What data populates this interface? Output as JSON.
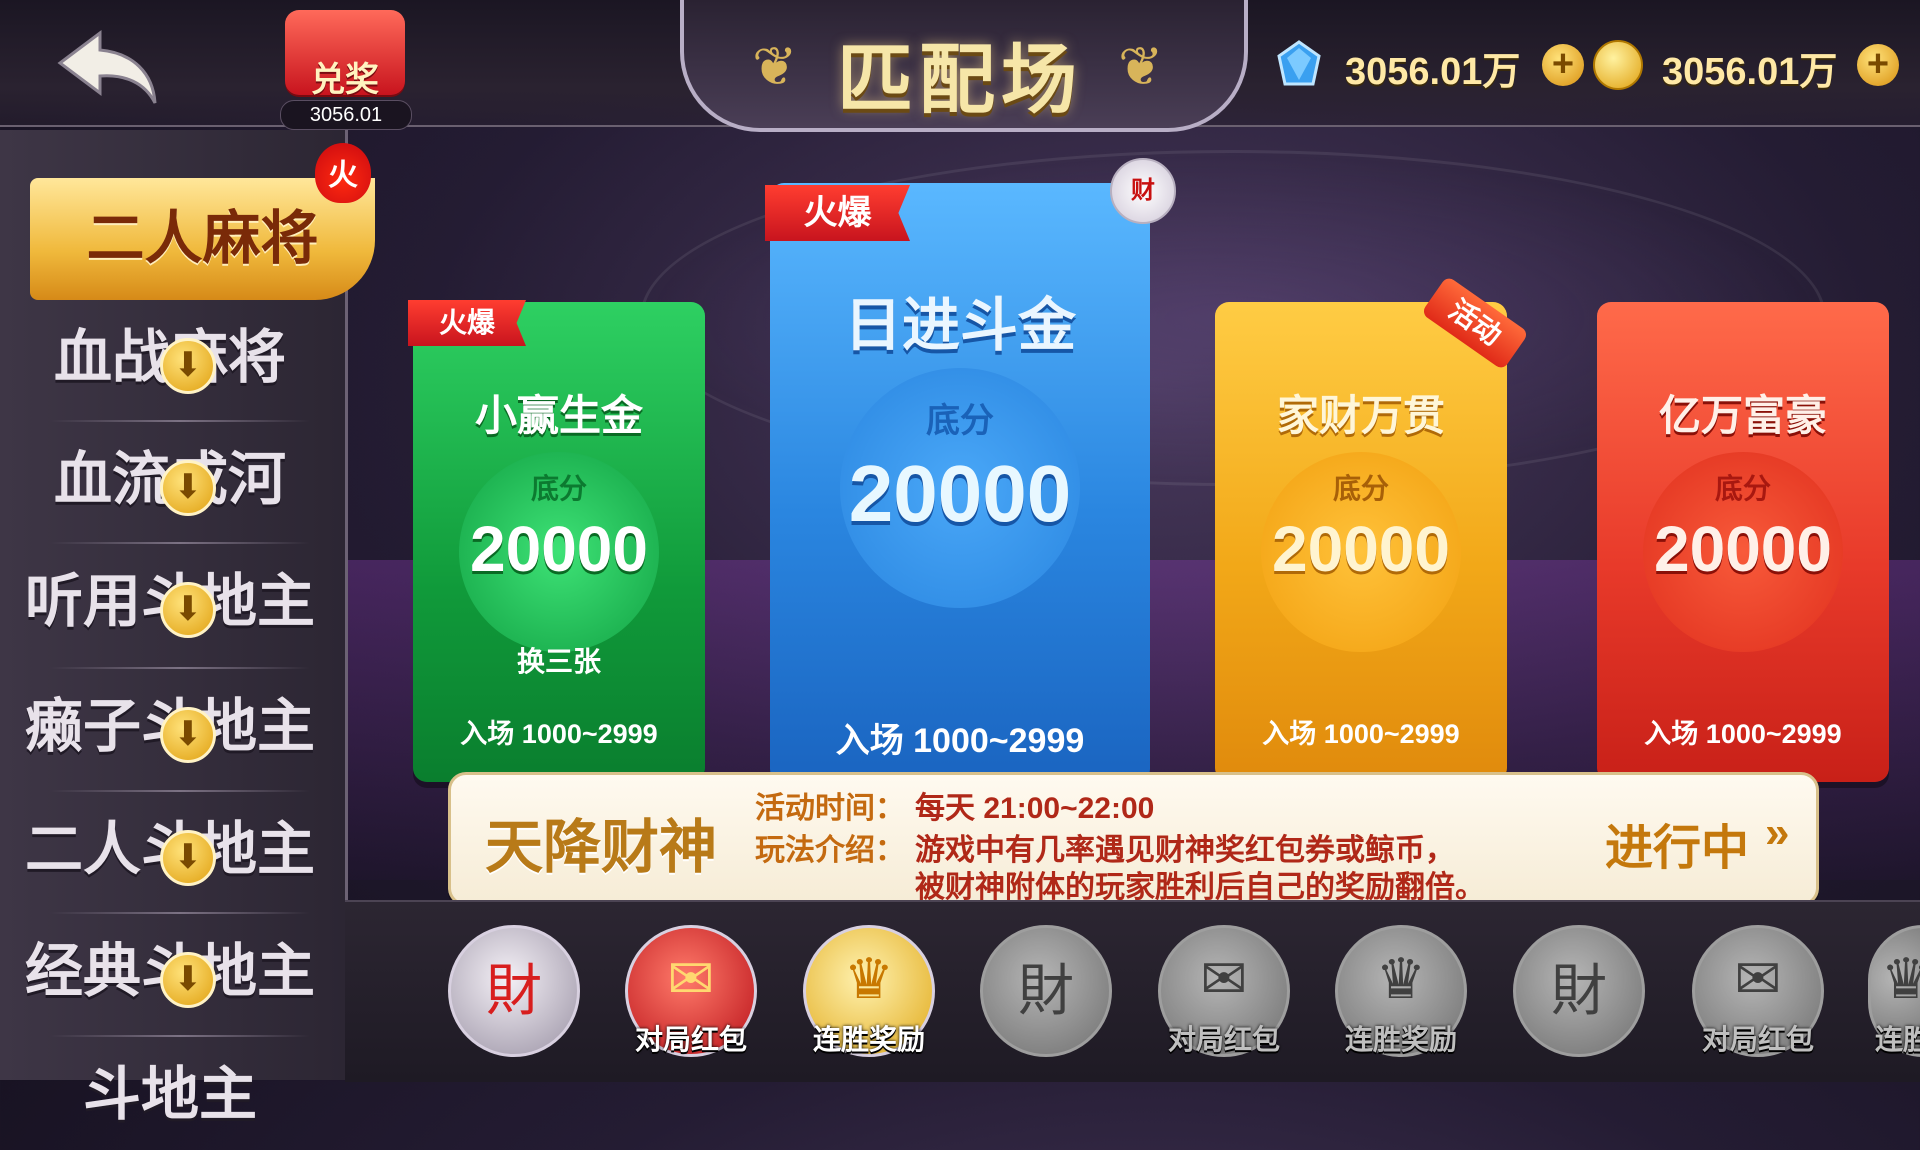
{
  "header": {
    "title": "匹配场",
    "redeem": {
      "label": "兑奖",
      "value": "3056.01"
    },
    "gem_balance": "3056.01万",
    "coin_balance": "3056.01万",
    "plus_symbol": "+"
  },
  "sidebar": {
    "items": [
      {
        "label": "二人麻将",
        "selected": true,
        "badge": "火"
      },
      {
        "label": "血战麻将"
      },
      {
        "label": "血流成河"
      },
      {
        "label": "听用斗地主"
      },
      {
        "label": "癞子斗地主"
      },
      {
        "label": "二人斗地主"
      },
      {
        "label": "经典斗地主"
      },
      {
        "label": "斗地主"
      }
    ],
    "download_symbol": "⬇"
  },
  "cards": [
    {
      "name": "小赢生金",
      "ribbon": "火爆",
      "base_label": "底分",
      "score": "20000",
      "extra": "换三张",
      "entry": "入场 1000~2999",
      "color": "#19b04a"
    },
    {
      "name": "日进斗金",
      "ribbon": "火爆",
      "base_label": "底分",
      "score": "20000",
      "entry": "入场 1000~2999",
      "color": "#2a8ee6"
    },
    {
      "name": "家财万贯",
      "tag": "活动",
      "base_label": "底分",
      "score": "20000",
      "entry": "入场 1000~2999",
      "color": "#f2a818"
    },
    {
      "name": "亿万富豪",
      "base_label": "底分",
      "score": "20000",
      "entry": "入场 1000~2999",
      "color": "#e83a2a"
    }
  ],
  "event": {
    "title": "天降财神",
    "time_label": "活动时间：",
    "time_value": "每天 21:00~22:00",
    "desc_label": "玩法介绍：",
    "desc_line1": "游戏中有几率遇见财神奖红包券或鲸币，",
    "desc_line2": "被财神附体的玩家胜利后自己的奖励翻倍。",
    "status": "进行中",
    "status_arrow": "»"
  },
  "activities": [
    {
      "label": "",
      "icon": "god-of-wealth-icon",
      "active": true
    },
    {
      "label": "对局红包",
      "icon": "red-envelope-icon",
      "active": true
    },
    {
      "label": "连胜奖励",
      "icon": "crown-icon",
      "active": true
    },
    {
      "label": "",
      "icon": "god-of-wealth-icon",
      "active": false
    },
    {
      "label": "对局红包",
      "icon": "red-envelope-icon",
      "active": false
    },
    {
      "label": "连胜奖励",
      "icon": "crown-icon",
      "active": false
    },
    {
      "label": "",
      "icon": "god-of-wealth-icon",
      "active": false
    },
    {
      "label": "对局红包",
      "icon": "red-envelope-icon",
      "active": false
    },
    {
      "label": "连胜",
      "icon": "crown-icon",
      "active": false
    }
  ]
}
